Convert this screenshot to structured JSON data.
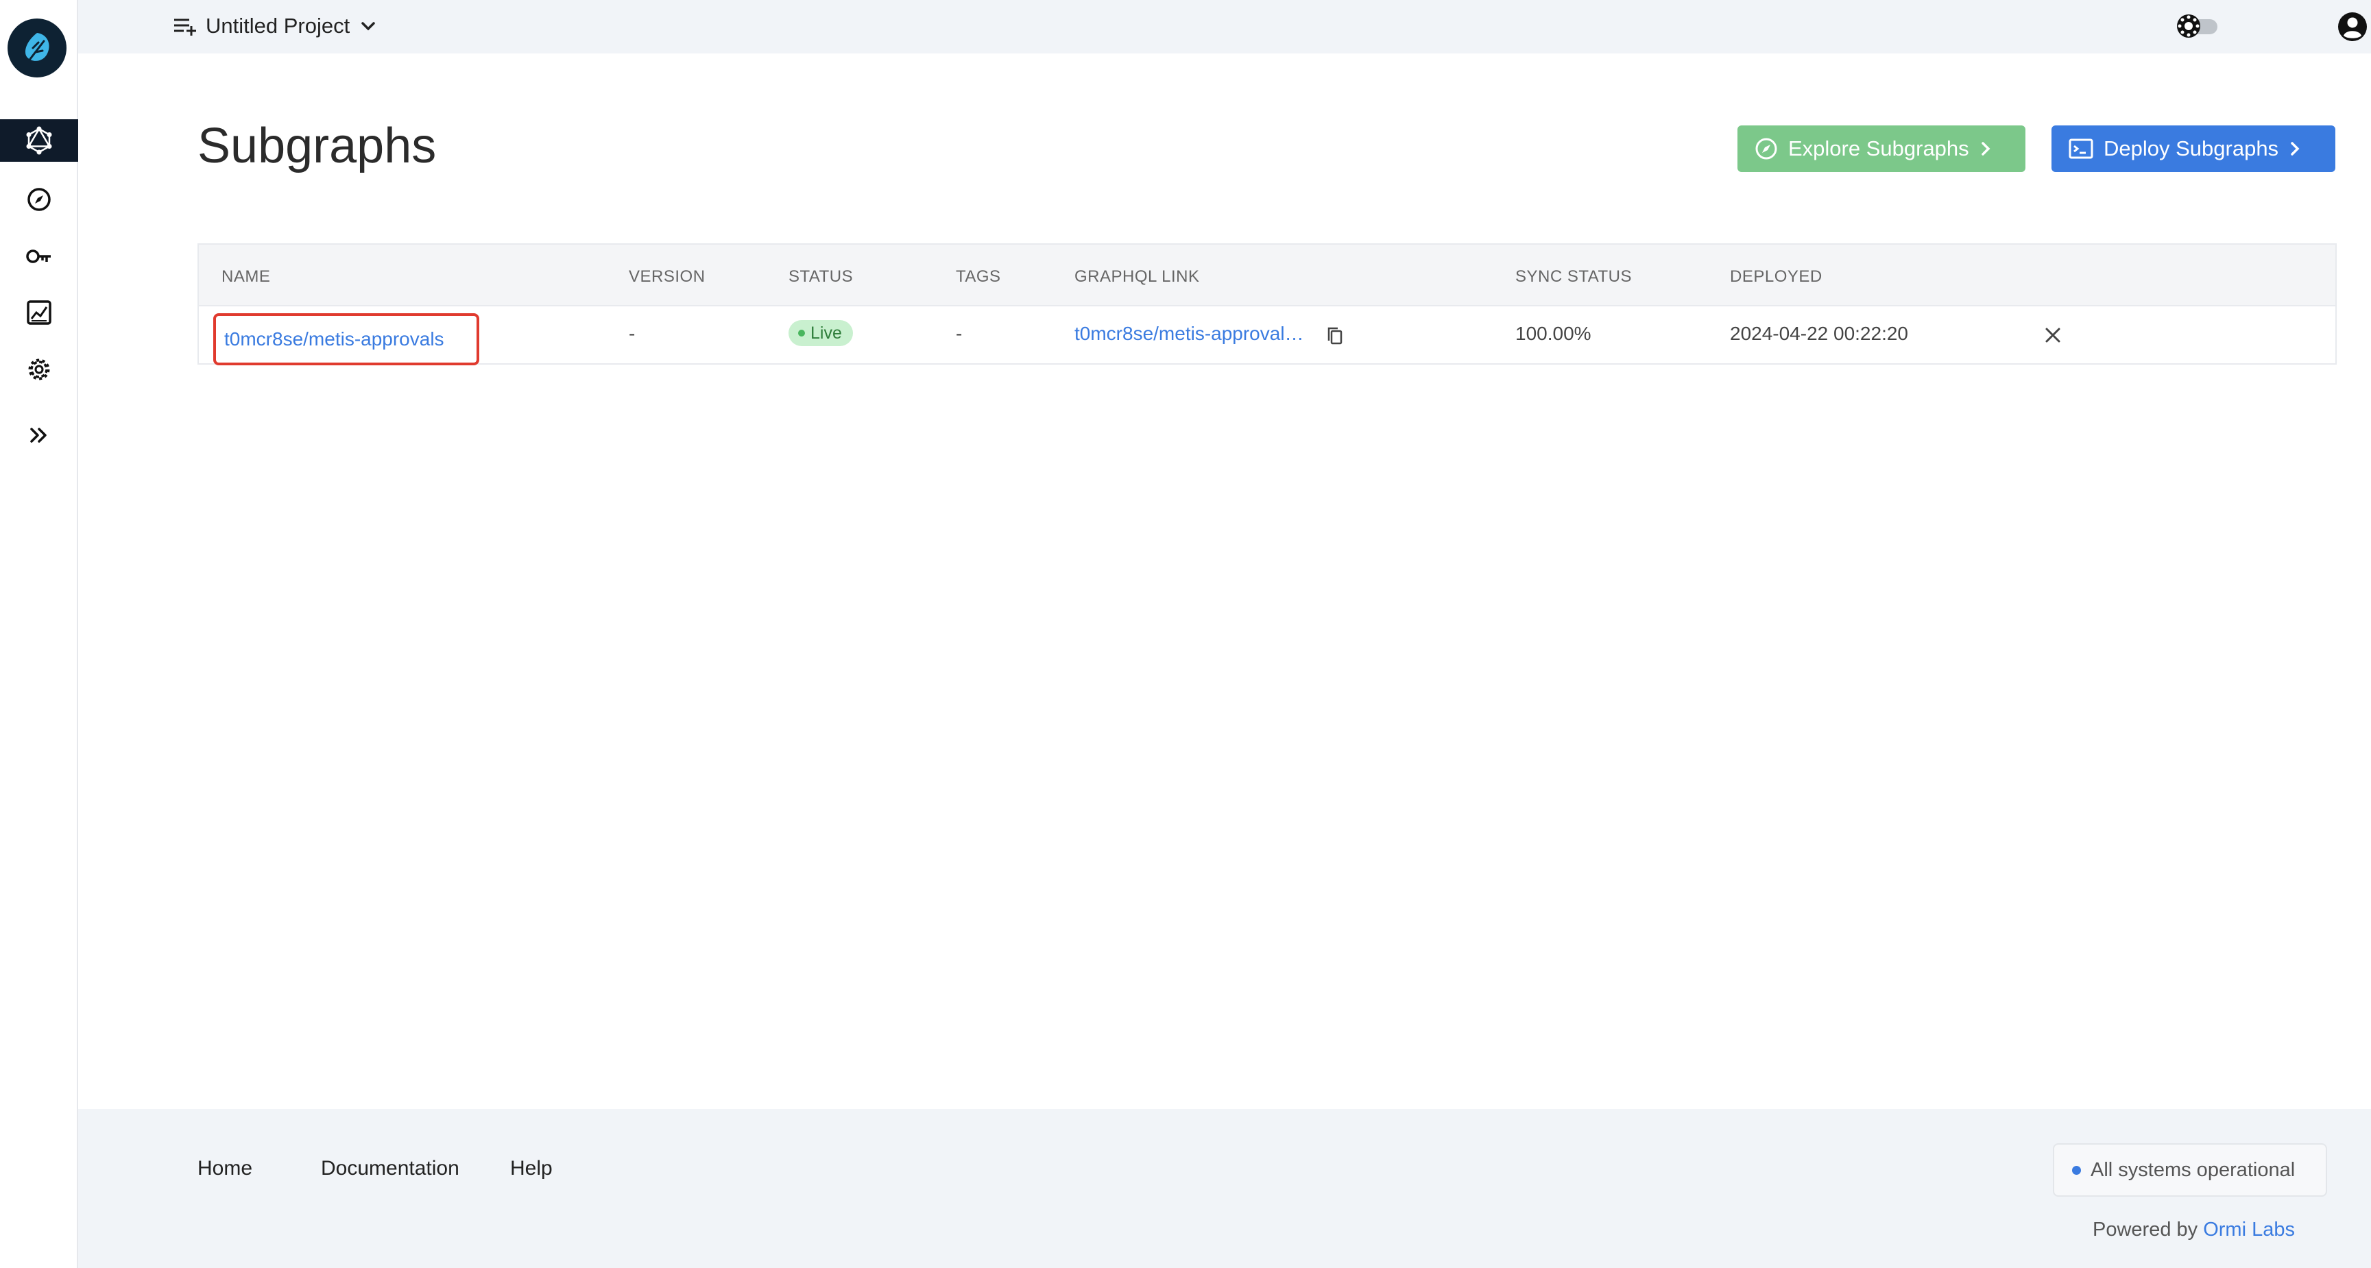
{
  "topbar": {
    "project_name": "Untitled Project"
  },
  "sidebar": {
    "items": [
      {
        "name": "subgraphs",
        "icon": "graphql-icon",
        "active": true
      },
      {
        "name": "explore",
        "icon": "compass-icon"
      },
      {
        "name": "api-keys",
        "icon": "key-icon"
      },
      {
        "name": "analytics",
        "icon": "chart-icon"
      },
      {
        "name": "settings",
        "icon": "gear-icon"
      },
      {
        "name": "expand",
        "icon": "double-chevron-right-icon"
      }
    ]
  },
  "main": {
    "title": "Subgraphs",
    "explore_button": "Explore Subgraphs",
    "deploy_button": "Deploy Subgraphs",
    "table": {
      "headers": {
        "name": "NAME",
        "version": "VERSION",
        "status": "STATUS",
        "tags": "TAGS",
        "graphql": "GRAPHQL LINK",
        "sync": "SYNC STATUS",
        "deployed": "DEPLOYED"
      },
      "rows": [
        {
          "name": "t0mcr8se/metis-approvals",
          "version": "-",
          "status": "Live",
          "tags": "-",
          "graphql_link": "t0mcr8se/metis-approval…",
          "sync_status": "100.00%",
          "deployed": "2024-04-22 00:22:20"
        }
      ]
    }
  },
  "footer": {
    "home": "Home",
    "documentation": "Documentation",
    "help": "Help",
    "system_status": "All systems operational",
    "powered_by": "Powered by",
    "company": "Ormi Labs"
  },
  "colors": {
    "accent": "#3a7be0",
    "explore": "#7cc88a",
    "live_badge": "#c9f0cf",
    "highlight": "#e03a2e"
  }
}
